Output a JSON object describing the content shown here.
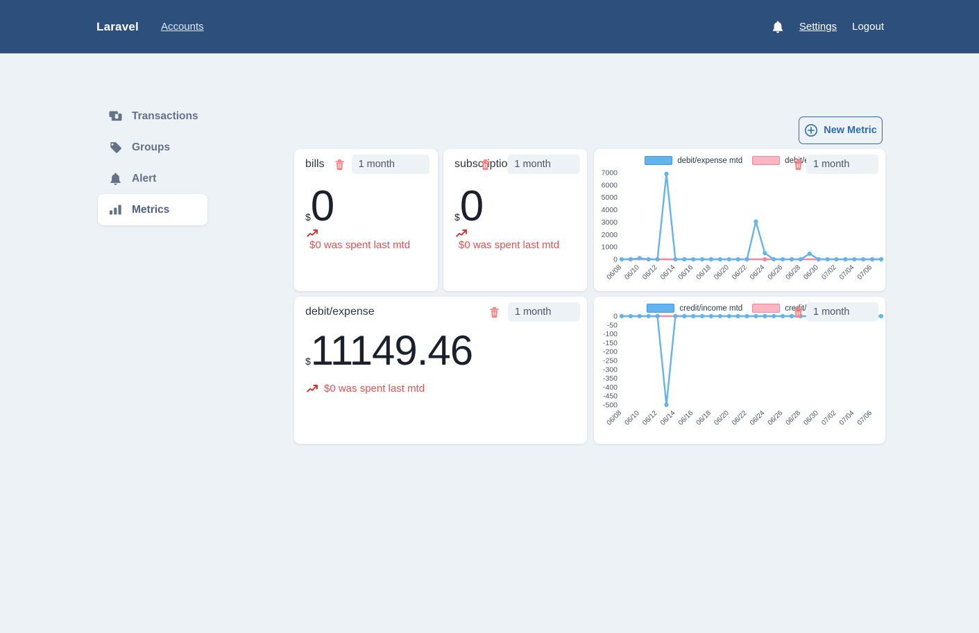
{
  "navbar": {
    "brand": "Laravel",
    "left_links": [
      {
        "label": "Accounts"
      }
    ],
    "bell_icon": "bell-icon",
    "right_links": [
      {
        "label": "Settings",
        "underline": true
      },
      {
        "label": "Logout",
        "underline": false
      }
    ]
  },
  "sidebar": {
    "items": [
      {
        "label": "Transactions",
        "icon": "transactions-icon",
        "active": false
      },
      {
        "label": "Groups",
        "icon": "tag-icon",
        "active": false
      },
      {
        "label": "Alert",
        "icon": "bell-icon",
        "active": false
      },
      {
        "label": "Metrics",
        "icon": "bar-chart-icon",
        "active": true
      }
    ]
  },
  "toolbar": {
    "new_metric_label": "New Metric",
    "new_metric_icon": "plus-circle-icon"
  },
  "cards": [
    {
      "id": "bills",
      "type": "kpi",
      "title": "bills",
      "delete_icon": "trash-icon",
      "period": "1 month",
      "currency": "$",
      "value": "0",
      "note": "$0 was spent last mtd",
      "note_icon": "trend-up-icon"
    },
    {
      "id": "subscription",
      "type": "kpi",
      "title": "subscription",
      "delete_icon": "trash-icon",
      "period": "1 month",
      "currency": "$",
      "value": "0",
      "note": "$0 was spent last mtd",
      "note_icon": "trend-up-icon"
    },
    {
      "id": "debit-expense",
      "type": "kpi",
      "title": "debit/expense",
      "delete_icon": "trash-icon",
      "period": "1 month",
      "currency": "$",
      "value": "11149.46",
      "note": "$0 was spent last mtd",
      "note_icon": "trend-up-icon"
    }
  ],
  "charts": [
    {
      "id": "debit-expense-chart",
      "period": "1 month",
      "delete_icon": "trash-icon"
    },
    {
      "id": "credit-income-chart",
      "period": "1 month",
      "delete_icon": "trash-icon"
    }
  ],
  "period_options": [
    "1 month"
  ],
  "colors": {
    "navbar": "#2d4f7c",
    "page_bg": "#edf2f7",
    "card_bg": "#ffffff",
    "accent": "#2b6cb0",
    "danger": "#e05252",
    "series_blue": "#63b3ed",
    "series_pink": "#f687a0",
    "sidebar_text": "#637186"
  },
  "chart_data": [
    {
      "type": "line",
      "id": "debit-expense-chart",
      "title": "",
      "xlabel": "",
      "ylabel": "",
      "ylim": [
        0,
        7000
      ],
      "yticks": [
        0,
        1000,
        2000,
        3000,
        4000,
        5000,
        6000,
        7000
      ],
      "grid": false,
      "legend": "top-center",
      "x": [
        "06/08",
        "06/09",
        "06/10",
        "06/11",
        "06/12",
        "06/13",
        "06/14",
        "06/15",
        "06/16",
        "06/17",
        "06/18",
        "06/19",
        "06/20",
        "06/21",
        "06/22",
        "06/23",
        "06/24",
        "06/25",
        "06/26",
        "06/27",
        "06/28",
        "06/29",
        "06/30",
        "07/01",
        "07/02",
        "07/03",
        "07/04",
        "07/05",
        "07/06",
        "07/07"
      ],
      "xtick_labels": [
        "06/08",
        "06/10",
        "06/12",
        "06/14",
        "06/16",
        "06/18",
        "06/20",
        "06/22",
        "06/24",
        "06/26",
        "06/28",
        "06/30",
        "07/02",
        "07/04",
        "07/06"
      ],
      "series": [
        {
          "name": "debit/expense mtd",
          "color": "#63b3ed",
          "values": [
            0,
            0,
            90,
            0,
            0,
            6900,
            0,
            0,
            0,
            0,
            0,
            0,
            0,
            0,
            0,
            3050,
            500,
            0,
            0,
            0,
            0,
            450,
            0,
            0,
            0,
            0,
            0,
            0,
            0,
            0
          ]
        },
        {
          "name": "debit/expense",
          "color": "#f687a0",
          "values": [
            0,
            0,
            0,
            0,
            0,
            0,
            0,
            0,
            0,
            0,
            0,
            0,
            0,
            0,
            0,
            0,
            0,
            0,
            0,
            0,
            0,
            0,
            0,
            0,
            0,
            0,
            0,
            0,
            0,
            0
          ]
        }
      ]
    },
    {
      "type": "line",
      "id": "credit-income-chart",
      "title": "",
      "xlabel": "",
      "ylabel": "",
      "ylim": [
        -500,
        0
      ],
      "yticks": [
        0,
        -50,
        -100,
        -150,
        -200,
        -250,
        -300,
        -350,
        -400,
        -450,
        -500
      ],
      "grid": false,
      "legend": "top-center",
      "x": [
        "06/08",
        "06/09",
        "06/10",
        "06/11",
        "06/12",
        "06/13",
        "06/14",
        "06/15",
        "06/16",
        "06/17",
        "06/18",
        "06/19",
        "06/20",
        "06/21",
        "06/22",
        "06/23",
        "06/24",
        "06/25",
        "06/26",
        "06/27",
        "06/28",
        "06/29",
        "06/30",
        "07/01",
        "07/02",
        "07/03",
        "07/04",
        "07/05",
        "07/06",
        "07/07"
      ],
      "xtick_labels": [
        "06/08",
        "06/10",
        "06/12",
        "06/14",
        "06/16",
        "06/18",
        "06/20",
        "06/22",
        "06/24",
        "06/26",
        "06/28",
        "06/30",
        "07/02",
        "07/04",
        "07/06"
      ],
      "series": [
        {
          "name": "credit/income mtd",
          "color": "#63b3ed",
          "values": [
            0,
            0,
            0,
            0,
            0,
            -500,
            0,
            0,
            0,
            0,
            0,
            0,
            0,
            0,
            0,
            0,
            0,
            0,
            0,
            0,
            0,
            0,
            0,
            0,
            0,
            0,
            0,
            0,
            0,
            0
          ]
        },
        {
          "name": "credit/income",
          "color": "#f687a0",
          "values": [
            0,
            0,
            0,
            0,
            0,
            0,
            0,
            0,
            0,
            0,
            0,
            0,
            0,
            0,
            0,
            0,
            0,
            0,
            0,
            0,
            0,
            0,
            0,
            0,
            0,
            0,
            0,
            0,
            0,
            0
          ]
        }
      ]
    }
  ]
}
